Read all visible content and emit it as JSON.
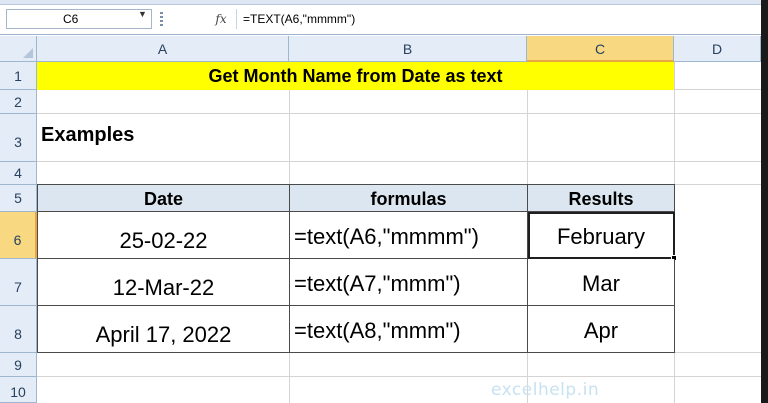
{
  "formula_bar": {
    "name_box": "C6",
    "fx_label": "fx",
    "formula": "=TEXT(A6,\"mmmm\")"
  },
  "columns": [
    "A",
    "B",
    "C",
    "D"
  ],
  "rows": [
    "1",
    "2",
    "3",
    "4",
    "5",
    "6",
    "7",
    "8",
    "9",
    "10"
  ],
  "sheet": {
    "title": "Get Month Name from Date as text",
    "examples_label": "Examples",
    "table": {
      "headers": [
        "Date",
        "formulas",
        "Results"
      ],
      "rows": [
        {
          "date": "25-02-22",
          "formula": "=text(A6,\"mmmm\")",
          "result": "February"
        },
        {
          "date": "12-Mar-22",
          "formula": "=text(A7,\"mmm\")",
          "result": "Mar"
        },
        {
          "date": "April 17, 2022",
          "formula": "=text(A8,\"mmm\")",
          "result": "Apr"
        }
      ]
    }
  },
  "watermark": "excelhelp.in",
  "colors": {
    "title_fill": "#ffff00",
    "header_fill": "#dce6f1",
    "active_header": "#f8d880"
  }
}
